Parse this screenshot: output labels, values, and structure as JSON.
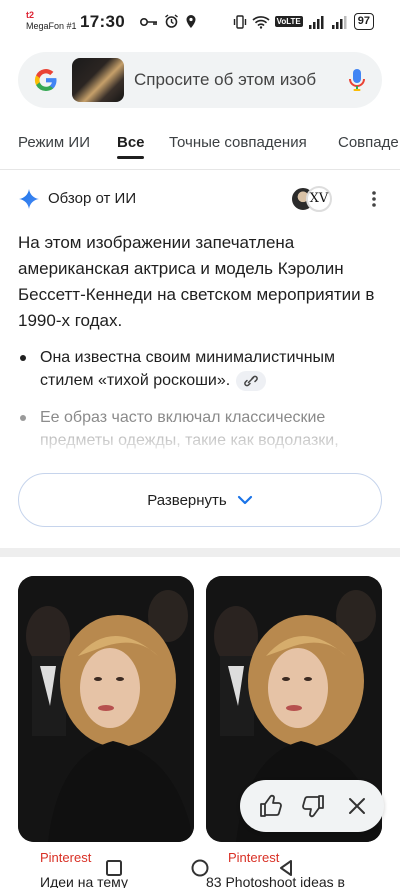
{
  "status_bar": {
    "sim_label": "t2",
    "carrier": "MegaFon #1",
    "time": "17:30",
    "volte": "VoLTE",
    "battery": "97"
  },
  "search": {
    "query": "Спросите об этом изоб"
  },
  "tabs": [
    {
      "label": "Режим ИИ"
    },
    {
      "label": "Все"
    },
    {
      "label": "Точные совпадения"
    },
    {
      "label": "Совпаде"
    }
  ],
  "ai_overview": {
    "title": "Обзор от ИИ",
    "paragraph": "На этом изображении запечатлена американская актриса и модель Кэролин Бессетт-Кеннеди на светском мероприятии в 1990-х годах.",
    "bullets": [
      "Она известна своим минималистичным стилем «тихой роскоши».",
      "Ее образ часто включал классические предметы одежды, такие как водолазки,"
    ],
    "source_avatar_text": "XV",
    "expand_label": "Развернуть"
  },
  "results": [
    {
      "source": "Pinterest",
      "title": "Идеи на тему"
    },
    {
      "source": "Pinterest",
      "title": "83 Photoshoot ideas в"
    }
  ],
  "colors": {
    "accent_blue": "#1a73e8",
    "source_red": "#d93025"
  },
  "icons": {
    "google": "google-logo-icon",
    "mic": "mic-icon",
    "ai": "sparkle-icon",
    "more": "more-vert-icon",
    "expand": "chevron-down-icon",
    "link": "link-icon",
    "like": "thumbs-up-icon",
    "dislike": "thumbs-down-icon",
    "close": "close-icon"
  }
}
